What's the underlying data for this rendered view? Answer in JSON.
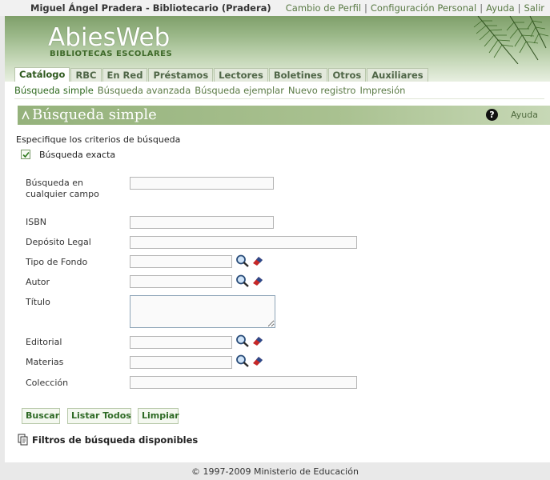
{
  "topbar": {
    "user": "Miguel Ángel Pradera - Bibliotecario (Pradera)",
    "links": [
      "Cambio de Perfil",
      "Configuración Personal",
      "Ayuda",
      "Salir"
    ]
  },
  "logo": {
    "main": "AbiesWeb",
    "sub": "BIBLIOTECAS ESCOLARES"
  },
  "tabs": [
    "Catálogo",
    "RBC",
    "En Red",
    "Préstamos",
    "Lectores",
    "Boletines",
    "Otros",
    "Auxiliares"
  ],
  "subnav": [
    "Búsqueda simple",
    "Búsqueda avanzada",
    "Búsqueda ejemplar",
    "Nuevo registro",
    "Impresión"
  ],
  "section": {
    "title": "Búsqueda simple",
    "help_label": "Ayuda",
    "help_icon": "help-circle-icon"
  },
  "form": {
    "criteria_label": "Especifique los criterios de búsqueda",
    "exact_label": "Búsqueda exacta",
    "exact_checked": true,
    "fields": {
      "any": "Búsqueda en\ncualquier campo",
      "isbn": "ISBN",
      "deposito": "Depósito Legal",
      "tipo": "Tipo de Fondo",
      "autor": "Autor",
      "titulo": "Título",
      "editorial": "Editorial",
      "materias": "Materias",
      "coleccion": "Colección"
    },
    "values": {
      "any": "",
      "isbn": "",
      "deposito": "",
      "tipo": "",
      "autor": "",
      "titulo": "",
      "editorial": "",
      "materias": "",
      "coleccion": ""
    }
  },
  "buttons": {
    "search": "Buscar",
    "list_all": "Listar Todos",
    "clear": "Limpiar"
  },
  "filters_label": "Filtros de búsqueda disponibles",
  "footer": "© 1997-2009 Ministerio de Educación",
  "colors": {
    "accent_green": "#2f6a1f",
    "link_green": "#5a7a45",
    "section_bar": "#a9c190"
  }
}
